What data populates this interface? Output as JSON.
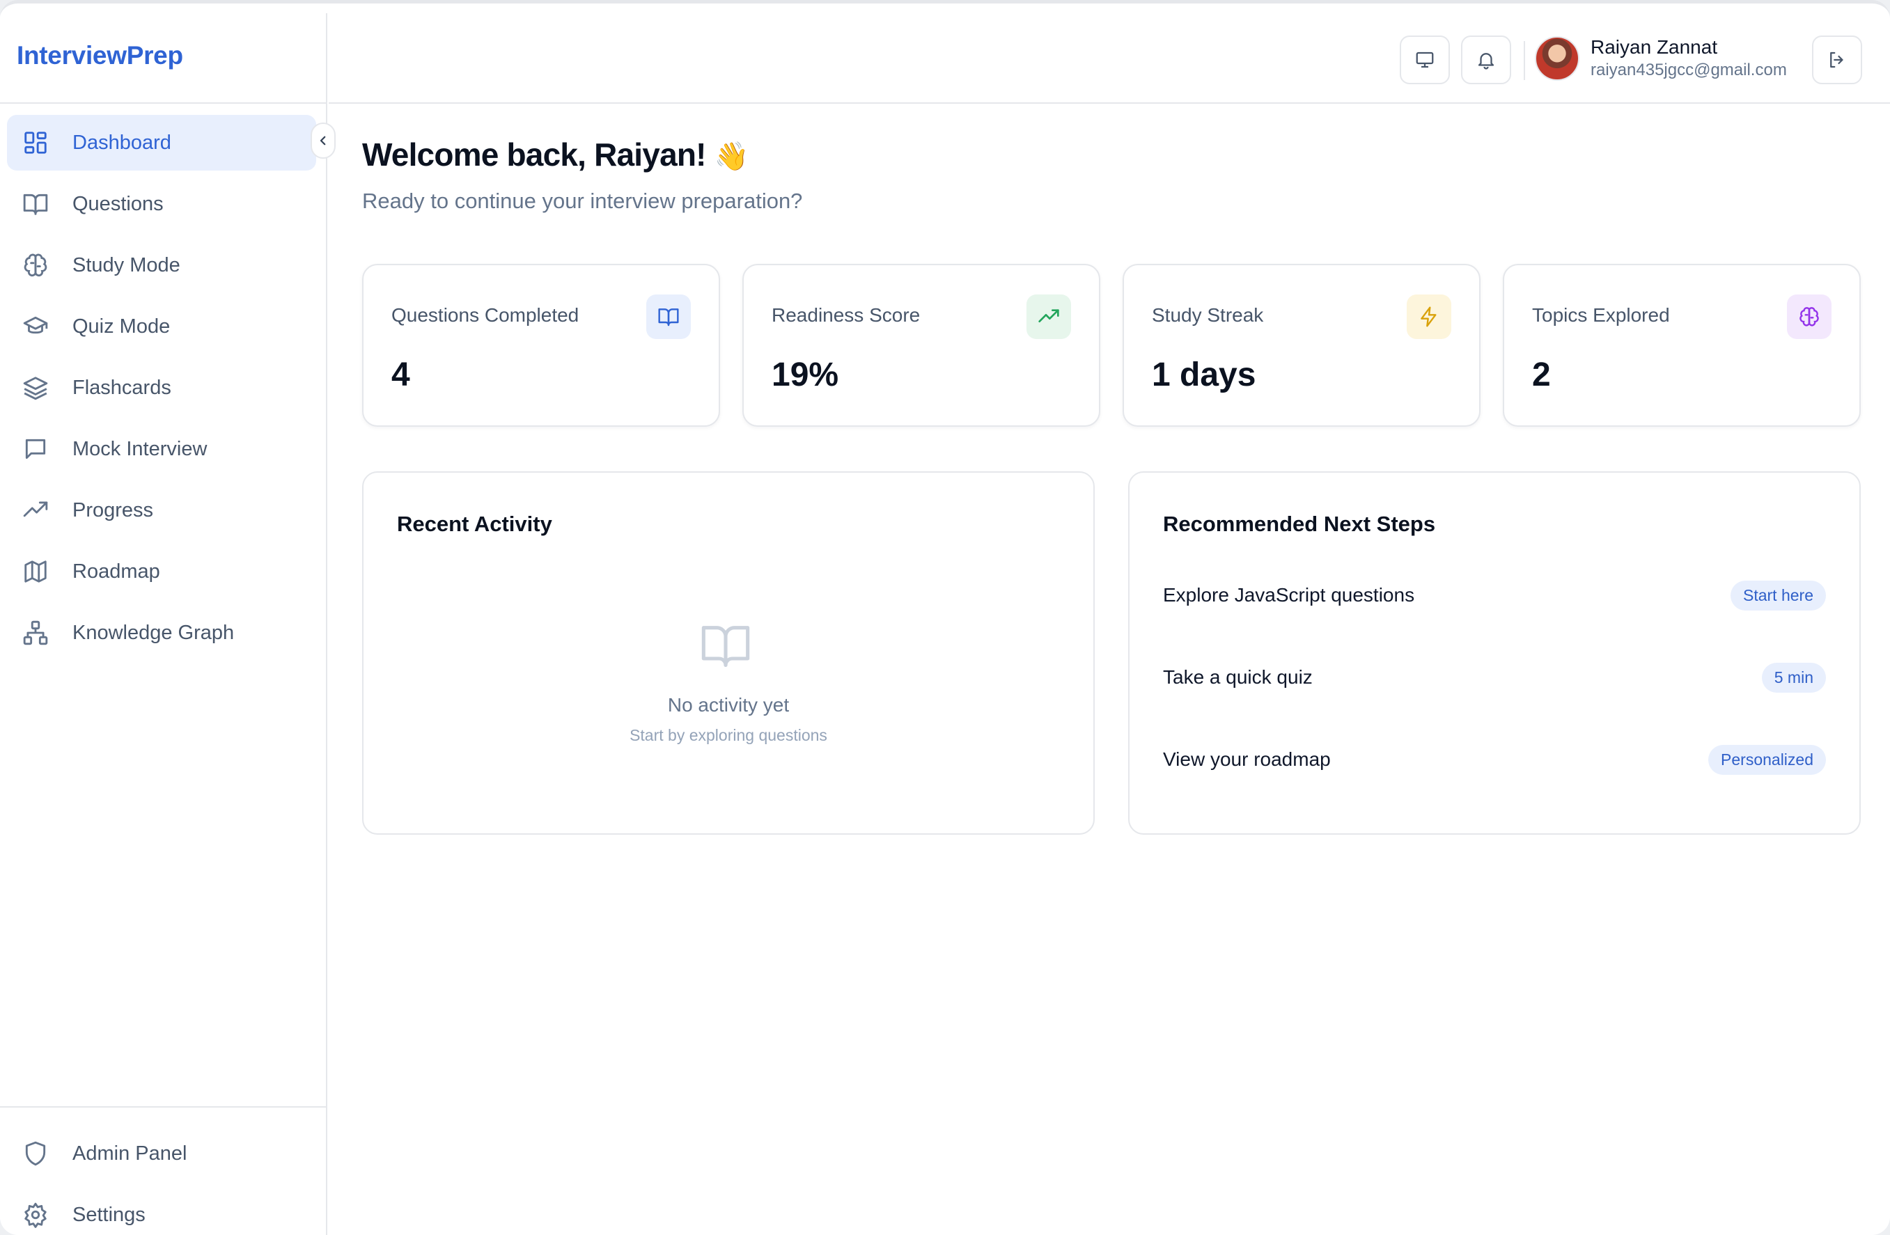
{
  "app": {
    "brand": "InterviewPrep"
  },
  "sidebar": {
    "items": [
      {
        "label": "Dashboard",
        "icon": "dashboard-grid-icon",
        "active": true
      },
      {
        "label": "Questions",
        "icon": "book-open-icon"
      },
      {
        "label": "Study Mode",
        "icon": "brain-icon"
      },
      {
        "label": "Quiz Mode",
        "icon": "graduation-cap-icon"
      },
      {
        "label": "Flashcards",
        "icon": "layers-icon"
      },
      {
        "label": "Mock Interview",
        "icon": "chat-bubble-icon"
      },
      {
        "label": "Progress",
        "icon": "trending-up-icon"
      },
      {
        "label": "Roadmap",
        "icon": "map-icon"
      },
      {
        "label": "Knowledge Graph",
        "icon": "network-icon"
      }
    ],
    "bottom_items": [
      {
        "label": "Admin Panel",
        "icon": "shield-icon"
      },
      {
        "label": "Settings",
        "icon": "gear-icon"
      }
    ]
  },
  "header": {
    "user": {
      "name": "Raiyan Zannat",
      "email": "raiyan435jgcc@gmail.com"
    }
  },
  "main": {
    "welcome": "Welcome back, Raiyan!",
    "welcome_emoji": "👋",
    "subtitle": "Ready to continue your interview preparation?",
    "stats": [
      {
        "label": "Questions Completed",
        "value": "4",
        "icon": "book-open-icon",
        "color": "#2f63d4",
        "bg": "#e8effd"
      },
      {
        "label": "Readiness Score",
        "value": "19%",
        "icon": "trending-up-icon",
        "color": "#22a55b",
        "bg": "#e7f6ec"
      },
      {
        "label": "Study Streak",
        "value": "1 days",
        "icon": "lightning-icon",
        "color": "#d9a20b",
        "bg": "#fdf5dc"
      },
      {
        "label": "Topics Explored",
        "value": "2",
        "icon": "brain-icon",
        "color": "#9333ea",
        "bg": "#f3e8fd"
      }
    ],
    "recent_activity": {
      "title": "Recent Activity",
      "empty_title": "No activity yet",
      "empty_subtitle": "Start by exploring questions"
    },
    "next_steps": {
      "title": "Recommended Next Steps",
      "items": [
        {
          "label": "Explore JavaScript questions",
          "badge": "Start here"
        },
        {
          "label": "Take a quick quiz",
          "badge": "5 min"
        },
        {
          "label": "View your roadmap",
          "badge": "Personalized"
        }
      ]
    }
  }
}
